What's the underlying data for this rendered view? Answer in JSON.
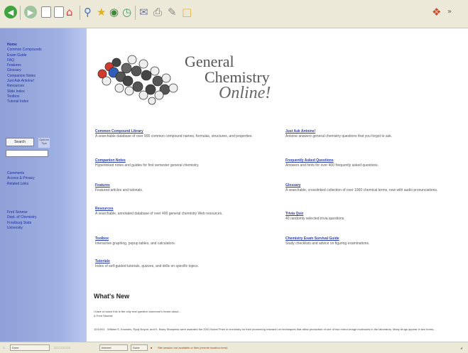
{
  "toolbar": {
    "icons": [
      "back-icon",
      "forward-icon",
      "stop-icon",
      "refresh-icon",
      "home-icon",
      "search-icon",
      "favorites-icon",
      "media-icon",
      "history-icon",
      "mail-icon",
      "print-icon",
      "edit-icon",
      "folder-icon"
    ],
    "colors": {
      "back": "#3fa33f",
      "forward": "#3fa33f"
    }
  },
  "sidebar": {
    "nav": [
      {
        "label": "Home",
        "bold": true
      },
      {
        "label": "Common Compounds",
        "bold": false
      },
      {
        "label": "Exam Guide",
        "bold": false
      },
      {
        "label": "FAQ",
        "bold": false
      },
      {
        "label": "Features",
        "bold": false
      },
      {
        "label": "Glossary",
        "bold": false
      },
      {
        "label": "Companion Notes",
        "bold": false
      },
      {
        "label": "Just Ask Antoine!",
        "bold": false
      },
      {
        "label": "Resources",
        "bold": false
      },
      {
        "label": "Slide Index",
        "bold": false
      },
      {
        "label": "Toolbox",
        "bold": false
      },
      {
        "label": "Tutorial Index",
        "bold": false
      }
    ],
    "search_button": "Search",
    "search_option": "Options Tips",
    "links2": [
      "Comments",
      "Access & Privacy",
      "Related Links"
    ],
    "links3": [
      "Fred Senese",
      "Dept. of Chemistry",
      "Frostburg State",
      "University"
    ]
  },
  "logo": {
    "line1": "General",
    "line2": "Chemistry",
    "line3": "Online!"
  },
  "features_left": [
    {
      "title": "Common Compound Library",
      "desc": "A searchable database of over 900 common compound names, formulas, structures, and properties."
    },
    {
      "title": "Companion Notes",
      "desc": "Hyperlinked notes and guides for first semester general chemistry."
    },
    {
      "title": "Features",
      "desc": "Featured articles and tutorials."
    },
    {
      "title": "Resources",
      "desc": "A searchable, annotated database of over 400 general chemistry Web resources."
    },
    {
      "title": "Toolbox",
      "desc": "Interactive graphing, popup tables, and calculators."
    },
    {
      "title": "Tutorials",
      "desc": "Index of self-guided tutorials, quizzes, and drills on specific topics."
    }
  ],
  "features_right": [
    {
      "title": "Just Ask Antoine!",
      "desc": "Antoine answers general chemistry questions that you forgot to ask."
    },
    {
      "title": "Frequently Asked Questions",
      "desc": "Answers and hints for over 400 frequently asked questions."
    },
    {
      "title": "Glossary",
      "desc": "A searchable, crosslinked collection of over 1000 chemical terms, now with audio pronunciations."
    },
    {
      "title": "Trivia Quiz",
      "desc": "40 randomly selected trivia questions."
    },
    {
      "title": "Chemistry Exam Survival Guide",
      "desc": "Study checklists and advice on figuring examinations."
    }
  ],
  "whats_new": {
    "title": "What's New",
    "item1": "I have a hunch this is the only real question someone's heard about...",
    "item1_sub": "& Fred Senese",
    "item2_date": "10/10/01",
    "item2": "William S. Knowles, Ryoji Noyori, and K. Barry Sharpless were awarded the 2001 Nobel Prize in chemistry for their pioneering research on techniques that allow production of one of two mirror-image molecules in the laboratory. Many drugs appear in two forms..."
  },
  "status": {
    "done": "Done",
    "zone": "Internet",
    "page": "Done",
    "message": "Site session not available or files (remote location-here)"
  }
}
